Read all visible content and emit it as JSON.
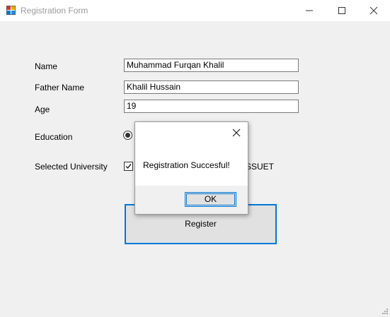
{
  "window": {
    "title": "Registration Form",
    "controls": [
      "minimize",
      "maximize",
      "close"
    ]
  },
  "form": {
    "name_label": "Name",
    "name_value": "Muhammad Furqan Khalil",
    "father_label": "Father Name",
    "father_value": "Khalil Hussain",
    "age_label": "Age",
    "age_value": "19",
    "education_label": "Education",
    "education_selected": true,
    "university_label": "Selected University",
    "university_checked": true,
    "university_value_visible": "SSUET",
    "register_label": "Register"
  },
  "dialog": {
    "message": "Registration Succesful!",
    "ok_label": "OK"
  },
  "colors": {
    "accent": "#0078d7",
    "window_bg": "#f0f0f0",
    "title_text": "#999999"
  },
  "icons": [
    "app-icon",
    "minimize-icon",
    "maximize-icon",
    "close-icon",
    "dialog-close-icon",
    "checkmark-icon",
    "resize-grip-icon"
  ]
}
